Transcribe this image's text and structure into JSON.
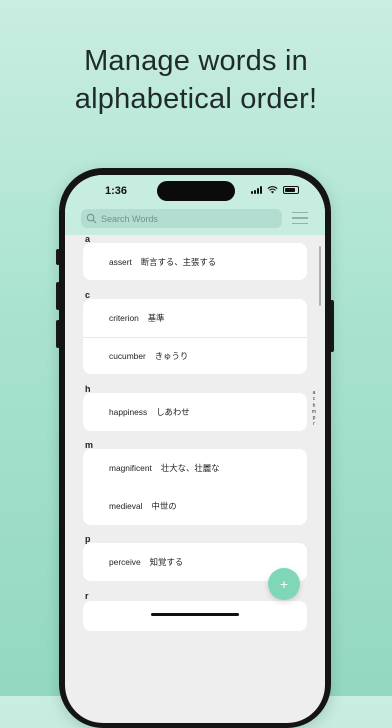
{
  "headline": {
    "line1": "Manage words in",
    "line2": "alphabetical order!"
  },
  "status_bar": {
    "time": "1:36"
  },
  "search": {
    "placeholder": "Search Words"
  },
  "sections": [
    {
      "letter": "a",
      "words": [
        {
          "word": "assert",
          "meaning": "断言する、主張する"
        }
      ]
    },
    {
      "letter": "c",
      "words": [
        {
          "word": "criterion",
          "meaning": "基準"
        },
        {
          "word": "cucumber",
          "meaning": "きゅうり"
        }
      ]
    },
    {
      "letter": "h",
      "words": [
        {
          "word": "happiness",
          "meaning": "しあわせ"
        }
      ]
    },
    {
      "letter": "m",
      "words": [
        {
          "word": "magnificent",
          "meaning": "壮大な、壮麗な"
        },
        {
          "word": "medieval",
          "meaning": "中世の"
        }
      ]
    },
    {
      "letter": "p",
      "words": [
        {
          "word": "perceive",
          "meaning": "知覚する"
        }
      ]
    },
    {
      "letter": "r",
      "words": []
    }
  ],
  "index_letters": [
    "a",
    "c",
    "h",
    "m",
    "p",
    "r"
  ],
  "fab": {
    "label": "+"
  },
  "colors": {
    "accent": "#7fd7b8",
    "header": "#c7ede0",
    "search_bg": "#b2ddd0"
  }
}
